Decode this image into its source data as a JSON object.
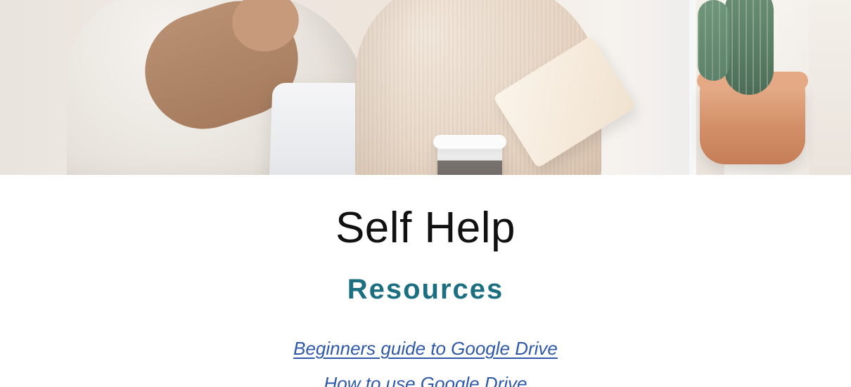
{
  "hero": {
    "image_alt": "People working at a laptop"
  },
  "main": {
    "title": "Self Help",
    "section_title": "Resources",
    "links": [
      {
        "label": "Beginners guide to Google Drive"
      },
      {
        "label": "How to use Google Drive"
      }
    ]
  },
  "colors": {
    "section_title": "#1b6f80",
    "link": "#2f59a8"
  }
}
